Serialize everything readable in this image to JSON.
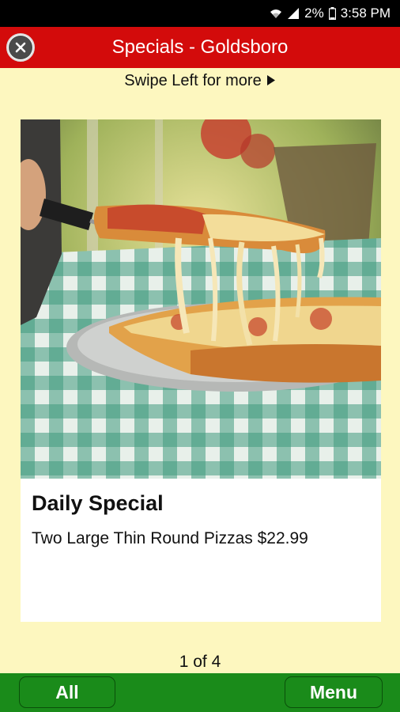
{
  "status_bar": {
    "battery_percent": "2%",
    "time": "3:58 PM",
    "icons": [
      "wifi-icon",
      "signal-icon",
      "battery-icon"
    ]
  },
  "header": {
    "title": "Specials - Goldsboro",
    "close_icon": "close-icon"
  },
  "hint": {
    "text": "Swipe Left for more",
    "icon": "play-arrow-icon"
  },
  "card": {
    "image": "pizza-photo",
    "title": "Daily Special",
    "description": "Two Large Thin Round Pizzas $22.99"
  },
  "pager": {
    "text": "1 of 4"
  },
  "bottom_bar": {
    "all_label": "All",
    "menu_label": "Menu"
  },
  "colors": {
    "header_red": "#d30b0b",
    "footer_green": "#1a8b1a",
    "background_yellow": "#fdf7bf"
  }
}
